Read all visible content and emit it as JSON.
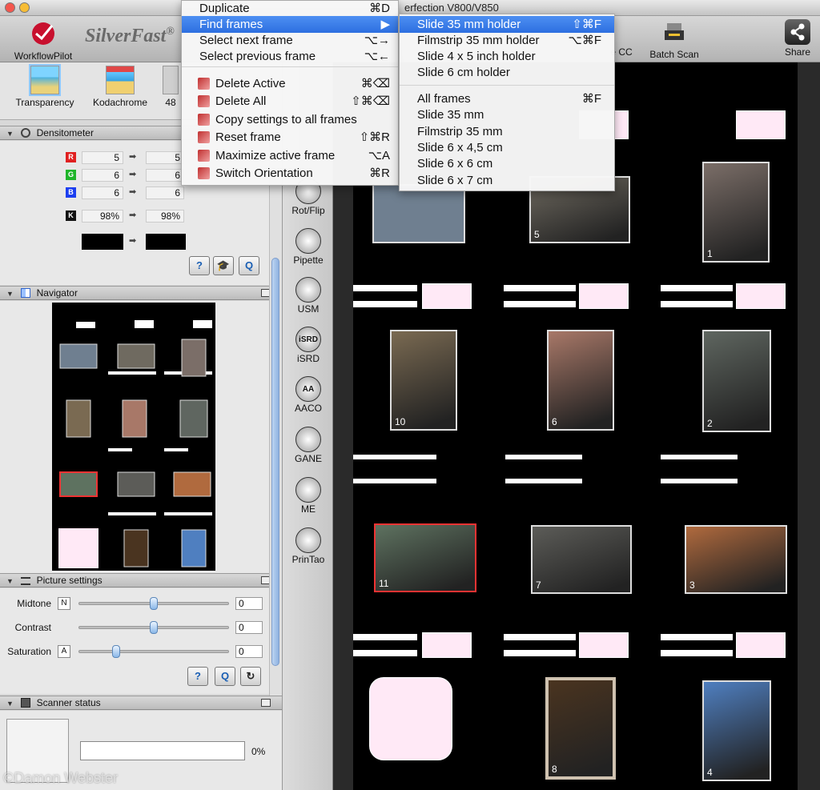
{
  "window": {
    "title": "erfection V800/V850"
  },
  "toolbar": {
    "workflow_label": "WorkflowPilot",
    "logo_text": "SilverFast",
    "logo_mark": "®",
    "batch_label": "Batch Scan",
    "cc_label": "e CC",
    "share_label": "Share"
  },
  "presets": [
    {
      "label": "Transparency"
    },
    {
      "label": "Kodachrome"
    },
    {
      "label": "48"
    }
  ],
  "densitometer": {
    "title": "Densitometer",
    "rows": [
      {
        "channel": "R",
        "color": "#e02020",
        "left": "5",
        "right": "5"
      },
      {
        "channel": "G",
        "color": "#1fb52a",
        "left": "6",
        "right": "6"
      },
      {
        "channel": "B",
        "color": "#1c3ff0",
        "left": "6",
        "right": "6"
      },
      {
        "channel": "K",
        "color": "#111111",
        "left": "98%",
        "right": "98%"
      }
    ]
  },
  "navigator": {
    "title": "Navigator"
  },
  "picture_settings": {
    "title": "Picture settings",
    "sliders": [
      {
        "label": "Midtone",
        "tag": "N",
        "value": "0",
        "position": 0.5
      },
      {
        "label": "Contrast",
        "tag": "",
        "value": "0",
        "position": 0.5
      },
      {
        "label": "Saturation",
        "tag": "A",
        "value": "0",
        "position": 0.25
      }
    ]
  },
  "scanner_status": {
    "title": "Scanner status",
    "progress_text": "0%",
    "progress": 0
  },
  "tools": [
    {
      "label": "Rot/Flip",
      "icon": "rotate-icon"
    },
    {
      "label": "Pipette",
      "icon": "pipette-icon"
    },
    {
      "label": "USM",
      "icon": "usm-icon"
    },
    {
      "label": "iSRD",
      "icon": "isrd-icon",
      "glyph": "iSRD"
    },
    {
      "label": "AACO",
      "icon": "aaco-icon",
      "glyph": "AA"
    },
    {
      "label": "GANE",
      "icon": "gane-icon"
    },
    {
      "label": "ME",
      "icon": "me-icon"
    },
    {
      "label": "PrinTao",
      "icon": "printao-icon"
    }
  ],
  "menu": {
    "items": [
      {
        "label": "Duplicate",
        "shortcut": "⌘D"
      },
      {
        "label": "Find frames",
        "shortcut": "▶",
        "highlighted": true
      },
      {
        "label": "Select next frame",
        "shortcut": "⌥→"
      },
      {
        "label": "Select previous frame",
        "shortcut": "⌥←"
      },
      {
        "label": "Delete Active",
        "shortcut": "⌘⌫",
        "icon": "delete-icon"
      },
      {
        "label": "Delete All",
        "shortcut": "⇧⌘⌫",
        "icon": "delete-all-icon"
      },
      {
        "label": "Copy settings to all frames",
        "shortcut": "",
        "icon": "copy-icon"
      },
      {
        "label": "Reset frame",
        "shortcut": "⇧⌘R",
        "icon": "reset-icon"
      },
      {
        "label": "Maximize active frame",
        "shortcut": "⌥A",
        "icon": "maximize-icon"
      },
      {
        "label": "Switch Orientation",
        "shortcut": "⌘R",
        "icon": "orientation-icon"
      }
    ]
  },
  "submenu": {
    "items": [
      {
        "label": "Slide 35 mm holder",
        "shortcut": "⇧⌘F",
        "highlighted": true
      },
      {
        "label": "Filmstrip 35 mm holder",
        "shortcut": "⌥⌘F"
      },
      {
        "label": "Slide 4 x 5 inch holder",
        "shortcut": ""
      },
      {
        "label": "Slide 6 cm holder",
        "shortcut": ""
      },
      {
        "label": "All frames",
        "shortcut": "⌘F"
      },
      {
        "label": "Slide 35 mm",
        "shortcut": ""
      },
      {
        "label": "Filmstrip 35 mm",
        "shortcut": ""
      },
      {
        "label": "Slide 6 x 4,5 cm",
        "shortcut": ""
      },
      {
        "label": "Slide 6 x 6 cm",
        "shortcut": ""
      },
      {
        "label": "Slide 6 x 7 cm",
        "shortcut": ""
      }
    ]
  },
  "frames": [
    {
      "num": "5",
      "color": "#6f6a60"
    },
    {
      "num": "1",
      "color": "#7b6e68"
    },
    {
      "num": "10",
      "color": "#7a6a52"
    },
    {
      "num": "6",
      "color": "#a87868"
    },
    {
      "num": "2",
      "color": "#5f6660"
    },
    {
      "num": "11",
      "color": "#5e7260"
    },
    {
      "num": "7",
      "color": "#5c5c58"
    },
    {
      "num": "3",
      "color": "#b06a3e"
    },
    {
      "num": "8",
      "color": "#4a3420"
    },
    {
      "num": "4",
      "color": "#4f7fc0"
    }
  ],
  "watermark": "©Damon Webster"
}
